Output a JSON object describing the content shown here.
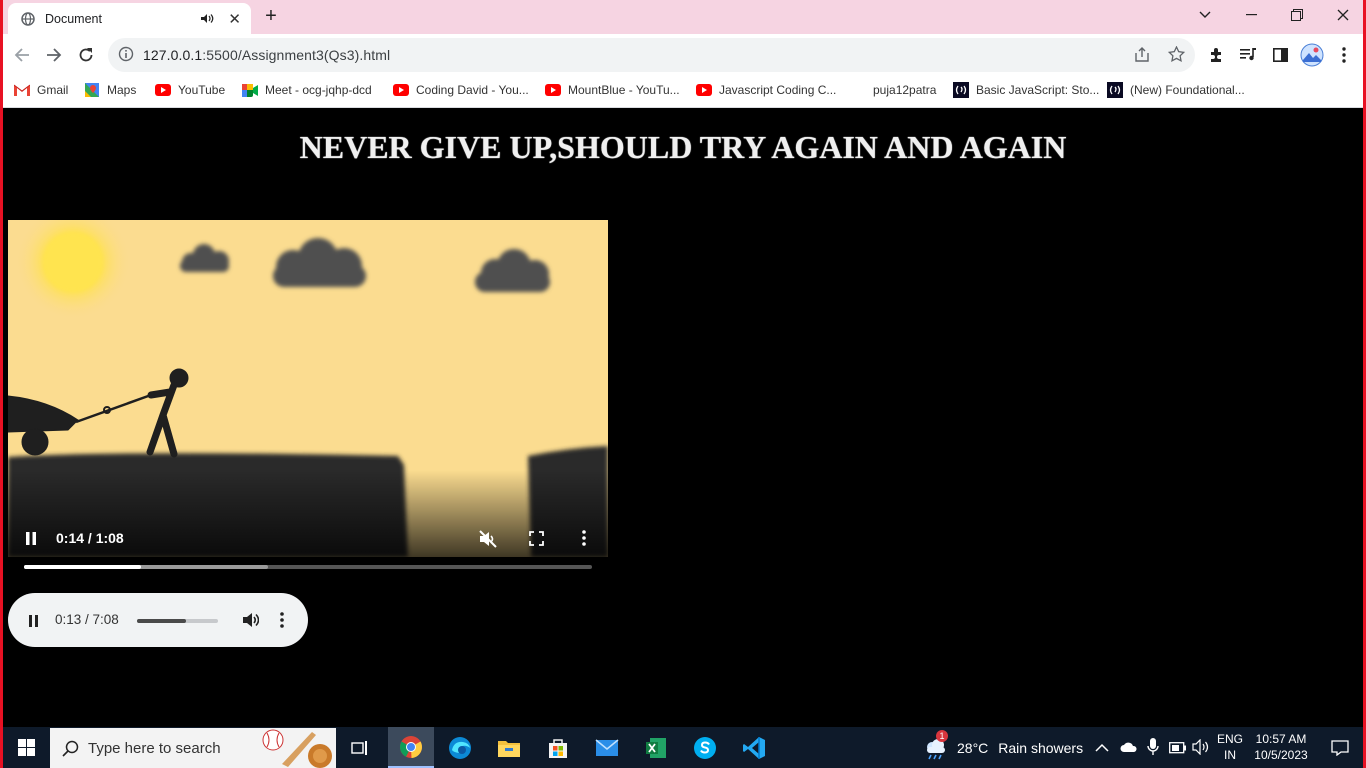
{
  "browser": {
    "tab_title": "Document",
    "url_host": "127.0.0.1",
    "url_rest": ":5500/Assignment3(Qs3).html"
  },
  "bookmarks": [
    {
      "label": "Gmail",
      "icon": "gmail-icon"
    },
    {
      "label": "Maps",
      "icon": "maps-icon"
    },
    {
      "label": "YouTube",
      "icon": "youtube-icon"
    },
    {
      "label": "Meet - ocg-jqhp-dcd",
      "icon": "meet-icon"
    },
    {
      "label": "Coding David - You...",
      "icon": "youtube-icon"
    },
    {
      "label": "MountBlue - YouTu...",
      "icon": "youtube-icon"
    },
    {
      "label": "Javascript Coding C...",
      "icon": "youtube-icon"
    },
    {
      "label": "puja12patra",
      "icon": "folder-icon"
    },
    {
      "label": "Basic JavaScript: Sto...",
      "icon": "freecodecamp-icon"
    },
    {
      "label": "(New) Foundational...",
      "icon": "freecodecamp-icon"
    }
  ],
  "page": {
    "heading": "NEVER GIVE UP,SHOULD TRY AGAIN AND AGAIN"
  },
  "video": {
    "time": "0:14 / 1:08",
    "played_fraction": 0.206,
    "buffered_fraction": 0.43,
    "muted": true
  },
  "audio": {
    "time": "0:13 / 7:08",
    "played_fraction": 0.03,
    "volume_fraction": 0.6
  },
  "taskbar": {
    "search_placeholder": "Type here to search",
    "weather_temp": "28°C",
    "weather_text": "Rain showers",
    "weather_badge": "1",
    "lang_line1": "ENG",
    "lang_line2": "IN",
    "time": "10:57 AM",
    "date": "10/5/2023"
  },
  "colors": {
    "window_border": "#e81123",
    "tabstrip": "#f6d4e2",
    "page_bg": "#000000",
    "taskbar": "#0e1a2a"
  }
}
